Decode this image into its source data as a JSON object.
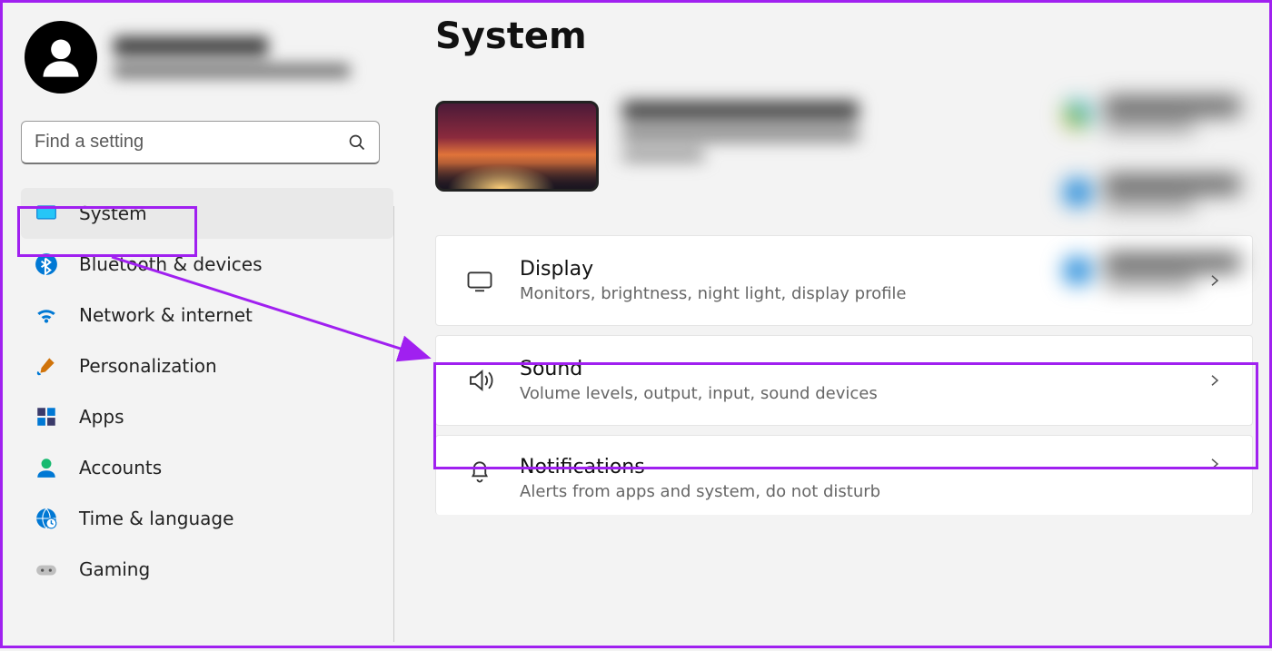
{
  "page_title": "System",
  "search": {
    "placeholder": "Find a setting"
  },
  "sidebar": {
    "items": [
      {
        "label": "System",
        "icon": "monitor-icon",
        "active": true
      },
      {
        "label": "Bluetooth & devices",
        "icon": "bluetooth-icon"
      },
      {
        "label": "Network & internet",
        "icon": "wifi-icon"
      },
      {
        "label": "Personalization",
        "icon": "brush-icon"
      },
      {
        "label": "Apps",
        "icon": "apps-icon"
      },
      {
        "label": "Accounts",
        "icon": "person-icon"
      },
      {
        "label": "Time & language",
        "icon": "globe-clock-icon"
      },
      {
        "label": "Gaming",
        "icon": "gamepad-icon"
      }
    ]
  },
  "settings": [
    {
      "title": "Display",
      "subtitle": "Monitors, brightness, night light, display profile",
      "icon": "display-icon"
    },
    {
      "title": "Sound",
      "subtitle": "Volume levels, output, input, sound devices",
      "icon": "sound-icon"
    },
    {
      "title": "Notifications",
      "subtitle": "Alerts from apps and system, do not disturb",
      "icon": "bell-icon"
    }
  ],
  "annotation": {
    "highlight_color": "#a020f0",
    "highlights": [
      "sidebar-item-system",
      "setting-row-display"
    ],
    "arrow": {
      "from": "sidebar-item-system",
      "to": "setting-row-display"
    }
  }
}
